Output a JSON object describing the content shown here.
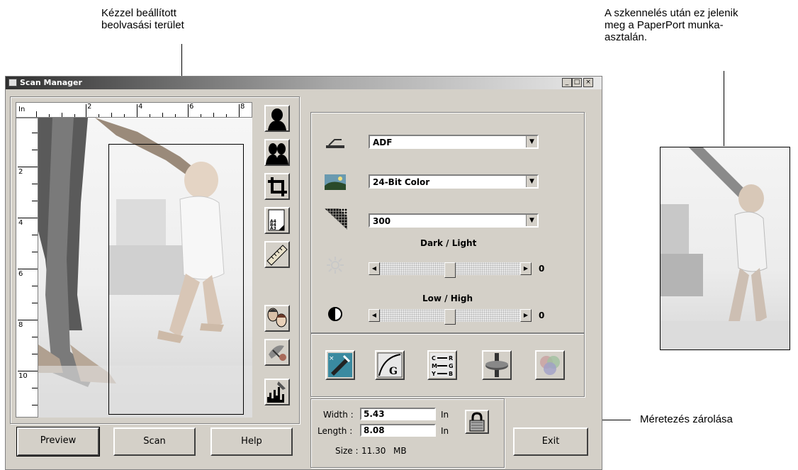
{
  "callouts": {
    "area_label_line1": "Kézzel beállított",
    "area_label_line2": "beolvasási terület",
    "paperport_line1": "A szkennelés után ez jelenik",
    "paperport_line2": "meg a PaperPort munka-",
    "paperport_line3": "asztalán.",
    "lock_label": "Méretezés zárolása"
  },
  "window": {
    "title": "Scan Manager",
    "minimize": "_",
    "maximize": "□",
    "close": "×"
  },
  "ruler": {
    "unit": "In",
    "h_labels": [
      "2",
      "4",
      "6",
      "8"
    ],
    "v_labels": [
      "2",
      "4",
      "6",
      "8",
      "10"
    ]
  },
  "settings": {
    "source": "ADF",
    "color_mode": "24-Bit Color",
    "resolution": "300",
    "brightness_label": "Dark / Light",
    "brightness_value": "0",
    "brightness_level": 0,
    "contrast_label": "Low / High",
    "contrast_value": "0",
    "contrast_level": 0
  },
  "dimensions": {
    "width_label": "Width :",
    "width_value": "5.43",
    "width_unit": "In",
    "length_label": "Length :",
    "length_value": "8.08",
    "length_unit": "In",
    "size_label": "Size :",
    "size_value": "11.30",
    "size_unit": "MB"
  },
  "buttons": {
    "preview": "Preview",
    "scan": "Scan",
    "help": "Help",
    "exit": "Exit"
  },
  "icons": {
    "tool_column": [
      "silhouette-icon",
      "dual-silhouette-icon",
      "crop-icon",
      "paper-size-icon",
      "ruler-icon",
      "faces-icon",
      "descreen-icon",
      "histogram-icon"
    ],
    "adjust_row": [
      "color-picker-icon",
      "gamma-curve-icon",
      "cmy-rgb-icon",
      "color-balance-icon",
      "color-filter-icon"
    ]
  }
}
